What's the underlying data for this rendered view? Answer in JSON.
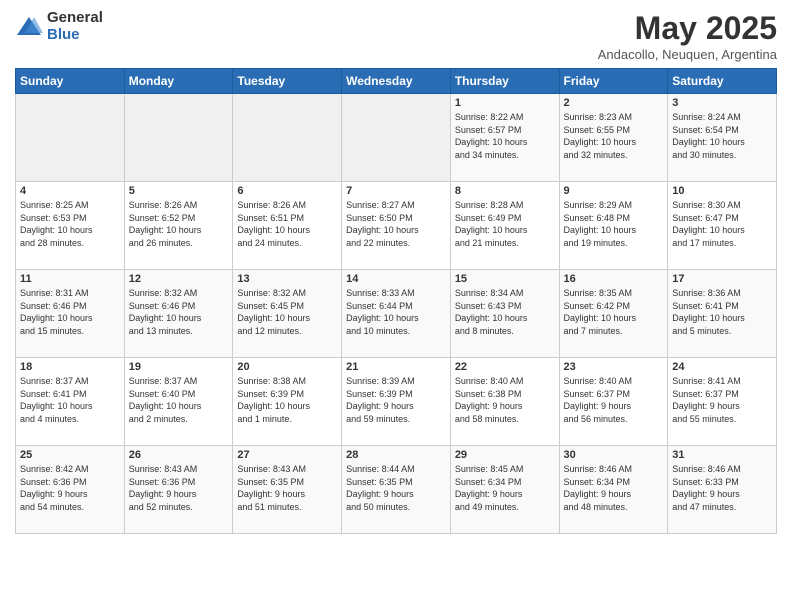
{
  "logo": {
    "general": "General",
    "blue": "Blue"
  },
  "title": "May 2025",
  "subtitle": "Andacollo, Neuquen, Argentina",
  "days_of_week": [
    "Sunday",
    "Monday",
    "Tuesday",
    "Wednesday",
    "Thursday",
    "Friday",
    "Saturday"
  ],
  "weeks": [
    [
      {
        "num": "",
        "info": ""
      },
      {
        "num": "",
        "info": ""
      },
      {
        "num": "",
        "info": ""
      },
      {
        "num": "",
        "info": ""
      },
      {
        "num": "1",
        "info": "Sunrise: 8:22 AM\nSunset: 6:57 PM\nDaylight: 10 hours\nand 34 minutes."
      },
      {
        "num": "2",
        "info": "Sunrise: 8:23 AM\nSunset: 6:55 PM\nDaylight: 10 hours\nand 32 minutes."
      },
      {
        "num": "3",
        "info": "Sunrise: 8:24 AM\nSunset: 6:54 PM\nDaylight: 10 hours\nand 30 minutes."
      }
    ],
    [
      {
        "num": "4",
        "info": "Sunrise: 8:25 AM\nSunset: 6:53 PM\nDaylight: 10 hours\nand 28 minutes."
      },
      {
        "num": "5",
        "info": "Sunrise: 8:26 AM\nSunset: 6:52 PM\nDaylight: 10 hours\nand 26 minutes."
      },
      {
        "num": "6",
        "info": "Sunrise: 8:26 AM\nSunset: 6:51 PM\nDaylight: 10 hours\nand 24 minutes."
      },
      {
        "num": "7",
        "info": "Sunrise: 8:27 AM\nSunset: 6:50 PM\nDaylight: 10 hours\nand 22 minutes."
      },
      {
        "num": "8",
        "info": "Sunrise: 8:28 AM\nSunset: 6:49 PM\nDaylight: 10 hours\nand 21 minutes."
      },
      {
        "num": "9",
        "info": "Sunrise: 8:29 AM\nSunset: 6:48 PM\nDaylight: 10 hours\nand 19 minutes."
      },
      {
        "num": "10",
        "info": "Sunrise: 8:30 AM\nSunset: 6:47 PM\nDaylight: 10 hours\nand 17 minutes."
      }
    ],
    [
      {
        "num": "11",
        "info": "Sunrise: 8:31 AM\nSunset: 6:46 PM\nDaylight: 10 hours\nand 15 minutes."
      },
      {
        "num": "12",
        "info": "Sunrise: 8:32 AM\nSunset: 6:46 PM\nDaylight: 10 hours\nand 13 minutes."
      },
      {
        "num": "13",
        "info": "Sunrise: 8:32 AM\nSunset: 6:45 PM\nDaylight: 10 hours\nand 12 minutes."
      },
      {
        "num": "14",
        "info": "Sunrise: 8:33 AM\nSunset: 6:44 PM\nDaylight: 10 hours\nand 10 minutes."
      },
      {
        "num": "15",
        "info": "Sunrise: 8:34 AM\nSunset: 6:43 PM\nDaylight: 10 hours\nand 8 minutes."
      },
      {
        "num": "16",
        "info": "Sunrise: 8:35 AM\nSunset: 6:42 PM\nDaylight: 10 hours\nand 7 minutes."
      },
      {
        "num": "17",
        "info": "Sunrise: 8:36 AM\nSunset: 6:41 PM\nDaylight: 10 hours\nand 5 minutes."
      }
    ],
    [
      {
        "num": "18",
        "info": "Sunrise: 8:37 AM\nSunset: 6:41 PM\nDaylight: 10 hours\nand 4 minutes."
      },
      {
        "num": "19",
        "info": "Sunrise: 8:37 AM\nSunset: 6:40 PM\nDaylight: 10 hours\nand 2 minutes."
      },
      {
        "num": "20",
        "info": "Sunrise: 8:38 AM\nSunset: 6:39 PM\nDaylight: 10 hours\nand 1 minute."
      },
      {
        "num": "21",
        "info": "Sunrise: 8:39 AM\nSunset: 6:39 PM\nDaylight: 9 hours\nand 59 minutes."
      },
      {
        "num": "22",
        "info": "Sunrise: 8:40 AM\nSunset: 6:38 PM\nDaylight: 9 hours\nand 58 minutes."
      },
      {
        "num": "23",
        "info": "Sunrise: 8:40 AM\nSunset: 6:37 PM\nDaylight: 9 hours\nand 56 minutes."
      },
      {
        "num": "24",
        "info": "Sunrise: 8:41 AM\nSunset: 6:37 PM\nDaylight: 9 hours\nand 55 minutes."
      }
    ],
    [
      {
        "num": "25",
        "info": "Sunrise: 8:42 AM\nSunset: 6:36 PM\nDaylight: 9 hours\nand 54 minutes."
      },
      {
        "num": "26",
        "info": "Sunrise: 8:43 AM\nSunset: 6:36 PM\nDaylight: 9 hours\nand 52 minutes."
      },
      {
        "num": "27",
        "info": "Sunrise: 8:43 AM\nSunset: 6:35 PM\nDaylight: 9 hours\nand 51 minutes."
      },
      {
        "num": "28",
        "info": "Sunrise: 8:44 AM\nSunset: 6:35 PM\nDaylight: 9 hours\nand 50 minutes."
      },
      {
        "num": "29",
        "info": "Sunrise: 8:45 AM\nSunset: 6:34 PM\nDaylight: 9 hours\nand 49 minutes."
      },
      {
        "num": "30",
        "info": "Sunrise: 8:46 AM\nSunset: 6:34 PM\nDaylight: 9 hours\nand 48 minutes."
      },
      {
        "num": "31",
        "info": "Sunrise: 8:46 AM\nSunset: 6:33 PM\nDaylight: 9 hours\nand 47 minutes."
      }
    ]
  ]
}
